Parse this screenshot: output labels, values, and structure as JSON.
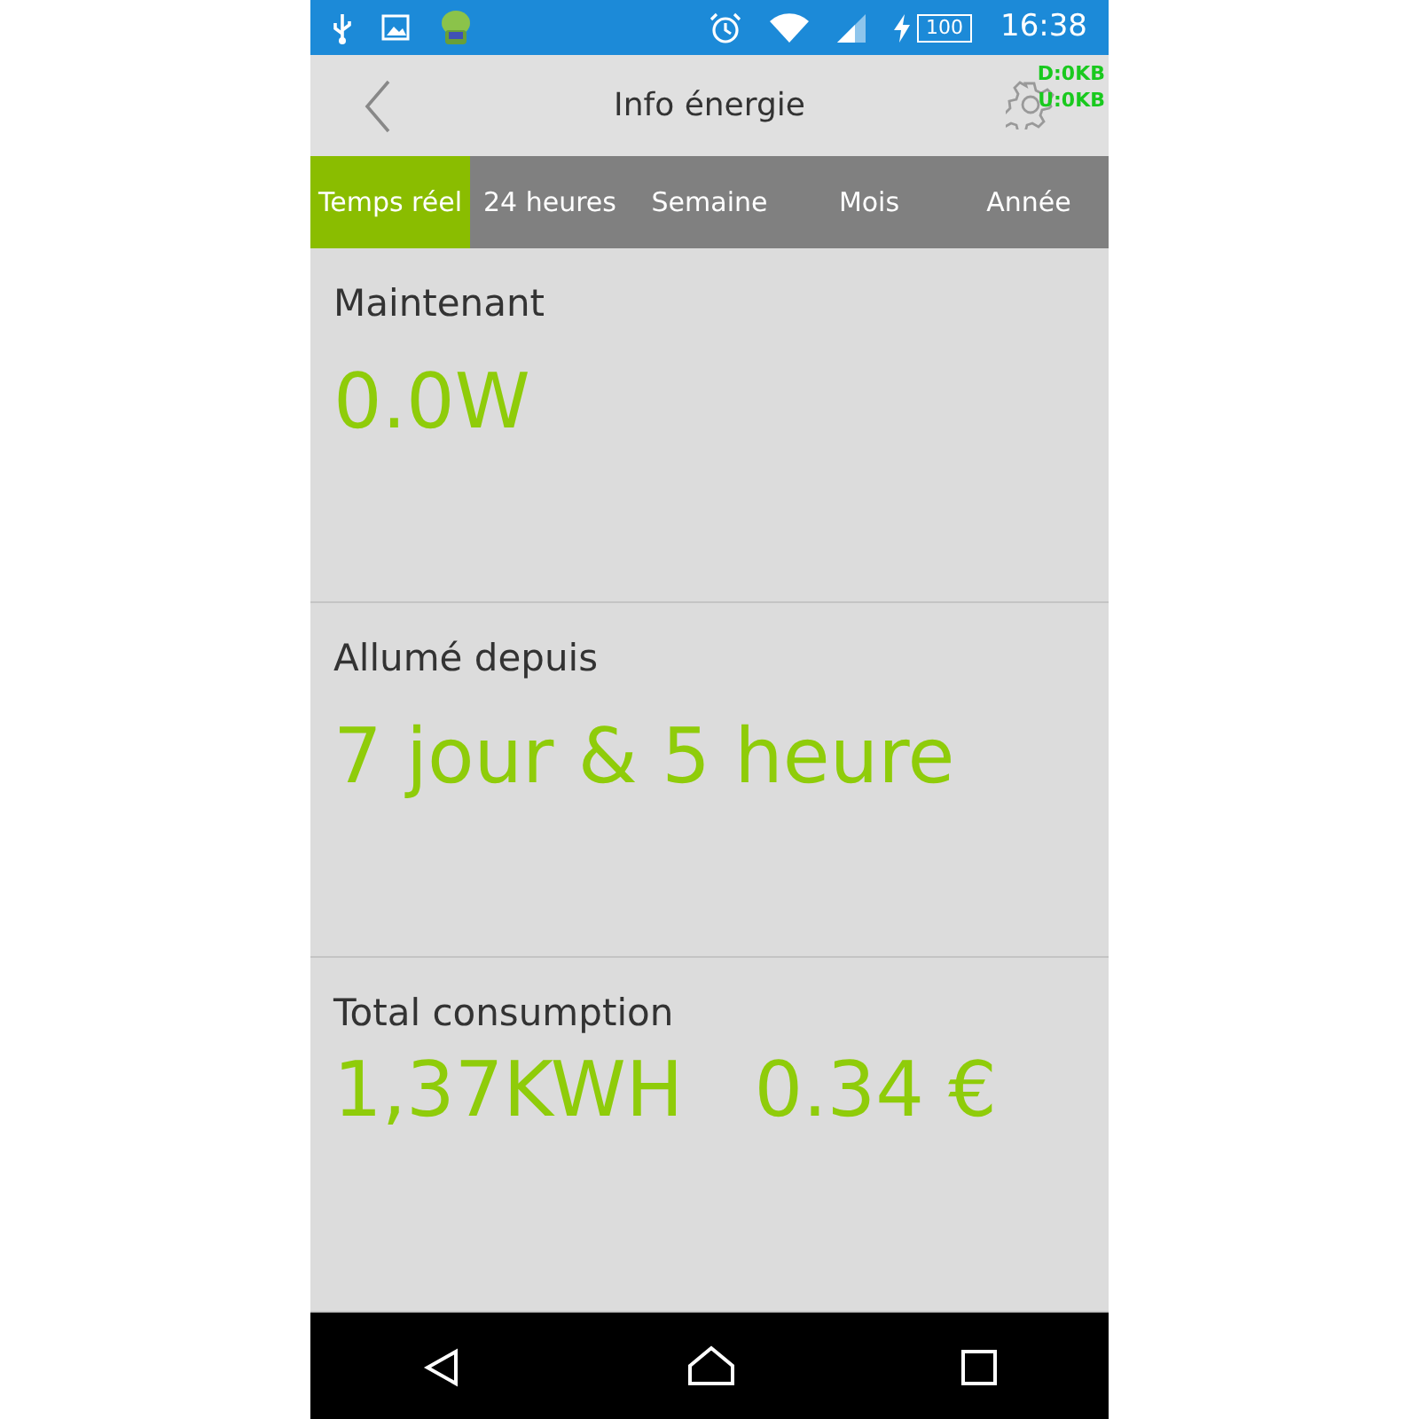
{
  "status_bar": {
    "battery": "100",
    "time": "16:38"
  },
  "header": {
    "title": "Info énergie",
    "traffic": [
      "D:0KB",
      "U:0KB"
    ]
  },
  "tabs": [
    {
      "label": "Temps réel",
      "selected": true
    },
    {
      "label": "24 heures",
      "selected": false
    },
    {
      "label": "Semaine",
      "selected": false
    },
    {
      "label": "Mois",
      "selected": false
    },
    {
      "label": "Année",
      "selected": false
    }
  ],
  "sections": [
    {
      "label": "Maintenant",
      "values": [
        "0.0W"
      ]
    },
    {
      "label": "Allumé depuis",
      "values": [
        "7 jour & 5 heure"
      ]
    },
    {
      "label": "Total consumption",
      "values": [
        "1,37KWH",
        "0.34 €"
      ]
    }
  ]
}
